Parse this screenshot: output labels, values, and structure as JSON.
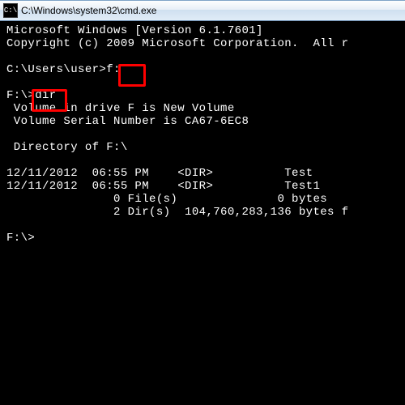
{
  "titlebar": {
    "icon_text": "C:\\",
    "title": "C:\\Windows\\system32\\cmd.exe"
  },
  "console": {
    "line1": "Microsoft Windows [Version 6.1.7601]",
    "line2": "Copyright (c) 2009 Microsoft Corporation.  All r",
    "blank1": "",
    "line3": "C:\\Users\\user>f:",
    "blank2": "",
    "line4": "F:\\>dir",
    "line5": " Volume in drive F is New Volume",
    "line6": " Volume Serial Number is CA67-6EC8",
    "blank3": "",
    "line7": " Directory of F:\\",
    "blank4": "",
    "line8": "12/11/2012  06:55 PM    <DIR>          Test",
    "line9": "12/11/2012  06:55 PM    <DIR>          Test1",
    "line10": "               0 File(s)              0 bytes",
    "line11": "               2 Dir(s)  104,760,283,136 bytes f",
    "blank5": "",
    "line12": "F:\\>"
  },
  "highlights": {
    "cmd1": "f:",
    "cmd2": "dir"
  }
}
